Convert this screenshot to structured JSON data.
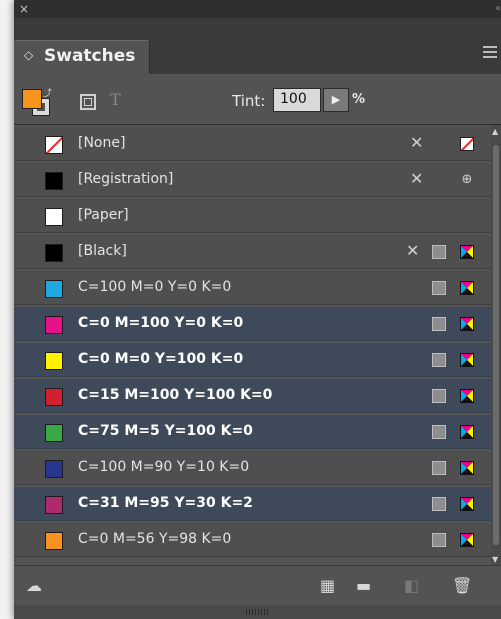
{
  "window": {
    "close_glyph": "×",
    "collapse_glyph": "‹‹"
  },
  "panel": {
    "tab_label": "Swatches",
    "tab_chevron": "◇",
    "menu_icon": "panel-menu-icon"
  },
  "controls": {
    "fill_color": "#f7941d",
    "text_button_glyph": "T",
    "tint_label": "Tint:",
    "tint_value": "100",
    "tint_stepper_glyph": "▶",
    "tint_unit": "%"
  },
  "swatches": [
    {
      "name": "[None]",
      "color": "none",
      "selected": false,
      "icons": [
        "pencil-crossed",
        "none"
      ]
    },
    {
      "name": "[Registration]",
      "color": "#000000",
      "selected": false,
      "icons": [
        "pencil-crossed",
        "registration"
      ]
    },
    {
      "name": "[Paper]",
      "color": "#ffffff",
      "selected": false,
      "icons": []
    },
    {
      "name": "[Black]",
      "color": "#000000",
      "selected": false,
      "icons": [
        "pencil-crossed",
        "process",
        "cmyk"
      ]
    },
    {
      "name": "C=100 M=0 Y=0 K=0",
      "color": "#1fa9e1",
      "selected": false,
      "icons": [
        "process",
        "cmyk"
      ]
    },
    {
      "name": "C=0 M=100 Y=0 K=0",
      "color": "#e5128c",
      "selected": true,
      "icons": [
        "process",
        "cmyk"
      ]
    },
    {
      "name": "C=0 M=0 Y=100 K=0",
      "color": "#fff200",
      "selected": true,
      "icons": [
        "process",
        "cmyk"
      ]
    },
    {
      "name": "C=15 M=100 Y=100 K=0",
      "color": "#d1202f",
      "selected": true,
      "icons": [
        "process",
        "cmyk"
      ]
    },
    {
      "name": "C=75 M=5 Y=100 K=0",
      "color": "#3aa845",
      "selected": true,
      "icons": [
        "process",
        "cmyk"
      ]
    },
    {
      "name": "C=100 M=90 Y=10 K=0",
      "color": "#27378f",
      "selected": false,
      "icons": [
        "process",
        "cmyk"
      ]
    },
    {
      "name": "C=31 M=95 Y=30 K=2",
      "color": "#ad2a6d",
      "selected": true,
      "icons": [
        "process",
        "cmyk"
      ]
    },
    {
      "name": "C=0 M=56 Y=98 K=0",
      "color": "#f7931e",
      "selected": false,
      "icons": [
        "process",
        "cmyk"
      ]
    }
  ],
  "footer": {
    "buttons": [
      "cloud-library-icon",
      "swatch-views-icon",
      "new-group-icon",
      "new-swatch-icon",
      "delete-icon"
    ]
  }
}
